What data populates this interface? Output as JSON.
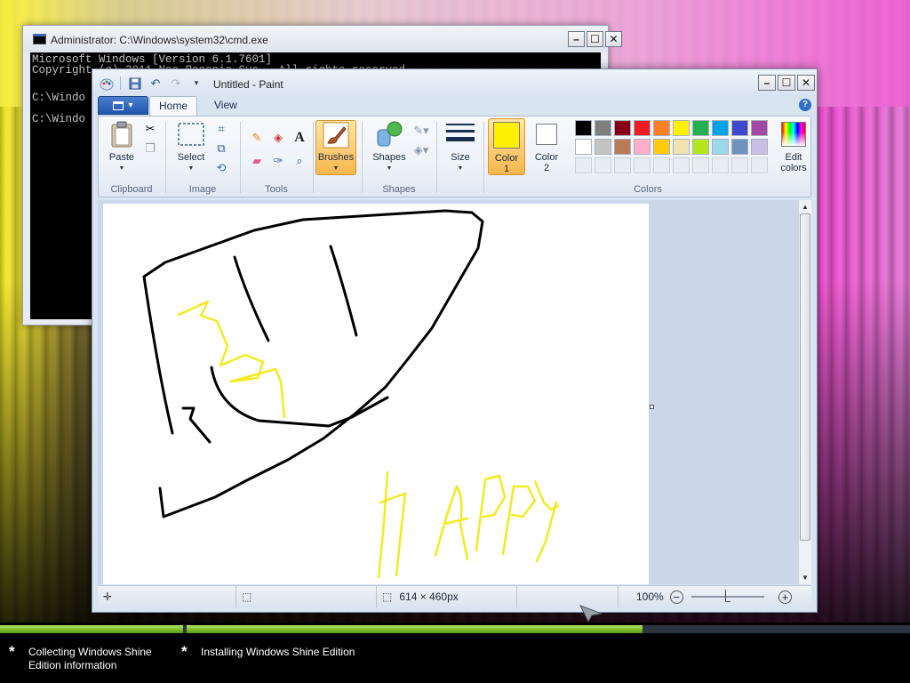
{
  "cmd": {
    "title": "Administrator: C:\\Windows\\system32\\cmd.exe",
    "lines": [
      "Microsoft Windows [Version 6.1.7601]",
      "Copyright (c) 2011 Neo Reconia Sys.  All rights reserved.",
      "",
      "C:\\Windo",
      "",
      "C:\\Windo"
    ]
  },
  "paint": {
    "title": "Untitled - Paint",
    "tabs": [
      "Home",
      "View"
    ],
    "groups": {
      "clipboard": "Clipboard",
      "image": "Image",
      "tools": "Tools",
      "shapes": "Shapes",
      "colors": "Colors"
    },
    "buttons": {
      "paste": "Paste",
      "select": "Select",
      "brushes": "Brushes",
      "shapes": "Shapes",
      "size": "Size",
      "color1_line1": "Color",
      "color1_line2": "1",
      "color2_line1": "Color",
      "color2_line2": "2",
      "edit_colors_line1": "Edit",
      "edit_colors_line2": "colors"
    },
    "color1": "#ffef00",
    "color2": "#ffffff",
    "palette_row1": [
      "#000000",
      "#7f7f7f",
      "#880015",
      "#ed1c24",
      "#ff7f27",
      "#fff200",
      "#22b14c",
      "#00a2e8",
      "#3f48cc",
      "#a349a4"
    ],
    "palette_row2": [
      "#ffffff",
      "#c3c3c3",
      "#b97a57",
      "#ffaec9",
      "#ffc90e",
      "#efe4b0",
      "#b5e61d",
      "#99d9ea",
      "#7092be",
      "#c8bfe7"
    ],
    "status": {
      "image_size": "614 × 460px",
      "zoom": "100%"
    }
  },
  "setup": {
    "step1": "Collecting Windows Shine\nEdition information",
    "step1_line1": "Collecting Windows Shine",
    "step1_line2": "Edition information",
    "step2": "Installing Windows Shine Edition",
    "progress_step1_fraction": 1.0,
    "progress_step2_fraction": 0.63
  }
}
